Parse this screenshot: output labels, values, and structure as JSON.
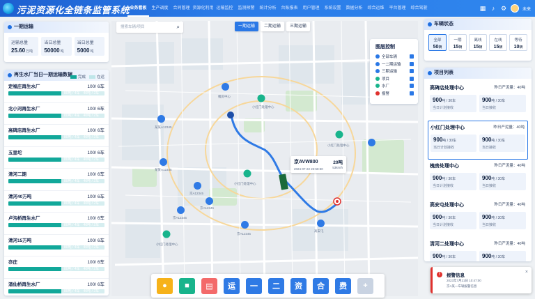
{
  "app": {
    "title": "污泥资源化全链条监管系统",
    "user": "未来"
  },
  "nav": [
    "业务看板",
    "生产调度",
    "合同管理",
    "资源化利用",
    "运输监控",
    "监测预警",
    "统计分析",
    "台账报表",
    "用户管理",
    "系统设置",
    "数据分析",
    "综合运维",
    "平台管理",
    "综合驾驶"
  ],
  "nav_active_index": 0,
  "top_icons": [
    "grid-icon",
    "bell-icon",
    "settings-icon"
  ],
  "search": {
    "placeholder": "搜索车辆/项目"
  },
  "map_toggle": [
    "一期运输",
    "二期运输",
    "三期运输"
  ],
  "map_toggle_active": 0,
  "kpi_panel": {
    "title": "一期运输",
    "items": [
      {
        "label": "运输总量",
        "value": "25.60",
        "unit": "万吨"
      },
      {
        "label": "当日总量",
        "value": "50000",
        "unit": "吨"
      },
      {
        "label": "当日总量",
        "value": "5000",
        "unit": "吨"
      }
    ]
  },
  "plants_panel": {
    "title": "再生水厂当日一期运输数据",
    "legend": [
      "完成",
      "在运"
    ],
    "plants": [
      {
        "name": "定福庄再生水厂",
        "count": "100",
        "unit": "/ 6车",
        "fill": 0.55,
        "a": "80吨 / 4车",
        "b": "40吨 / 2车"
      },
      {
        "name": "北小河再生水厂",
        "count": "100",
        "unit": "/ 6车",
        "fill": 0.55,
        "a": "80吨 / 4车",
        "b": "40吨 / 2车"
      },
      {
        "name": "高碑店再生水厂",
        "count": "100",
        "unit": "/ 6车",
        "fill": 0.55,
        "a": "80吨 / 4车",
        "b": "40吨 / 2车"
      },
      {
        "name": "五里坨",
        "count": "100",
        "unit": "/ 6车",
        "fill": 0.55,
        "a": "80吨 / 4车",
        "b": "40吨 / 2车"
      },
      {
        "name": "清河二期",
        "count": "100",
        "unit": "/ 6车",
        "fill": 0.55,
        "a": "80吨 / 4车",
        "b": "40吨 / 2车"
      },
      {
        "name": "清河40万吨",
        "count": "100",
        "unit": "/ 6车",
        "fill": 0.55,
        "a": "80吨 / 4车",
        "b": "40吨 / 2车"
      },
      {
        "name": "卢沟桥再生水厂",
        "count": "100",
        "unit": "/ 6车",
        "fill": 0.55,
        "a": "80吨 / 4车",
        "b": "40吨 / 2车"
      },
      {
        "name": "清河15万吨",
        "count": "100",
        "unit": "/ 6车",
        "fill": 0.55,
        "a": "80吨 / 4车",
        "b": "40吨 / 2车"
      },
      {
        "name": "亦庄",
        "count": "100",
        "unit": "/ 6车",
        "fill": 0.55,
        "a": "80吨 / 4车",
        "b": "40吨 / 2车"
      },
      {
        "name": "酒仙桥再生水厂",
        "count": "100",
        "unit": "/ 6车",
        "fill": 0.55,
        "a": "80吨 / 4车",
        "b": "40吨 / 2车"
      }
    ]
  },
  "layers": {
    "title": "图层控制",
    "items": [
      "全部车辆",
      "一二期运输",
      "三期运输",
      "项目",
      "水厂",
      "报警"
    ]
  },
  "vehicle": {
    "plate": "京AVW800",
    "load": "20吨",
    "time": "2024-07-22 22:58:30",
    "speed": "53km/h"
  },
  "map_labels": {
    "l1": "槐房中心",
    "l2": "小红门处理中心",
    "l3": "高安屯",
    "l4": "某某A12345",
    "l5": "小红门处理中心",
    "l6": "某某A12345",
    "l7": "京A12345",
    "l8": "京A12345",
    "l9": "小红门处理中心",
    "l10": "京A12345",
    "l11": "小红门处理中心",
    "l12": "京A12345"
  },
  "vehicle_status": {
    "title": "车辆状态",
    "items": [
      {
        "label": "全部",
        "value": "50",
        "unit": "辆"
      },
      {
        "label": "一期",
        "value": "15",
        "unit": "辆"
      },
      {
        "label": "离线",
        "value": "15",
        "unit": "辆"
      },
      {
        "label": "在线",
        "value": "15",
        "unit": "辆"
      },
      {
        "label": "等待",
        "value": "10",
        "unit": "辆"
      }
    ]
  },
  "projects": {
    "title": "项目列表",
    "items": [
      {
        "name": "高碑店处理中心",
        "capacity": "昨日产泥量：40吨",
        "v1": "900",
        "u1": "吨 / 30车",
        "l1": "当日计划接收",
        "v2": "900",
        "u2": "吨 / 30车",
        "l2": "当日接收"
      },
      {
        "name": "小红门处理中心",
        "capacity": "昨日产泥量：40吨",
        "v1": "900",
        "u1": "吨 / 30车",
        "l1": "当日计划接收",
        "v2": "900",
        "u2": "吨 / 30车",
        "l2": "当日接收"
      },
      {
        "name": "槐房处理中心",
        "capacity": "昨日产泥量：40吨",
        "v1": "900",
        "u1": "吨 / 30车",
        "l1": "当日计划接收",
        "v2": "900",
        "u2": "吨 / 30车",
        "l2": "当日接收"
      },
      {
        "name": "高安屯处理中心",
        "capacity": "昨日产泥量：40吨",
        "v1": "900",
        "u1": "吨 / 30车",
        "l1": "当日计划接收",
        "v2": "900",
        "u2": "吨 / 30车",
        "l2": "当日接收"
      },
      {
        "name": "清河二处理中心",
        "capacity": "昨日产泥量：40吨",
        "v1": "900",
        "u1": "吨 / 30车",
        "l1": "当日计划接收",
        "v2": "900",
        "u2": "吨 / 30车",
        "l2": "当日接收"
      }
    ],
    "selected_index": 1
  },
  "alert": {
    "title": "报警信息",
    "date": "2023年7月21日 10:47:00",
    "msg": "京A某一车辆报警信息",
    "close": "×"
  },
  "toolbar": [
    {
      "name": "location-button",
      "glyph": "●",
      "cls": "y"
    },
    {
      "name": "video-button",
      "glyph": "■",
      "cls": "g"
    },
    {
      "name": "map-button",
      "glyph": "▤",
      "cls": "r"
    },
    {
      "name": "transport-button",
      "glyph": "运",
      "cls": "b"
    },
    {
      "name": "phase1-button",
      "glyph": "一",
      "cls": "b"
    },
    {
      "name": "phase2-button",
      "glyph": "二",
      "cls": "b"
    },
    {
      "name": "resource-button",
      "glyph": "资",
      "cls": "b"
    },
    {
      "name": "contract-button",
      "glyph": "合",
      "cls": "b"
    },
    {
      "name": "fee-button",
      "glyph": "费",
      "cls": "b"
    },
    {
      "name": "add-button",
      "glyph": "+",
      "cls": "gr"
    }
  ],
  "colors": {
    "primary": "#2a78e6",
    "teal": "#12a89a",
    "alert": "#e0312d",
    "route": "#2f7ae5"
  }
}
